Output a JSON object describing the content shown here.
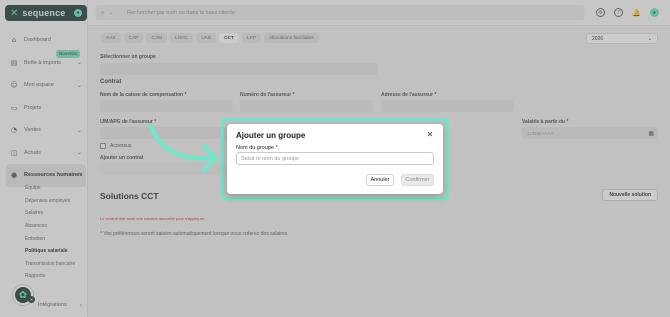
{
  "brand": {
    "name": "sequence",
    "accent": "#65e6c2",
    "dark": "#1f3d3a"
  },
  "sidebar": {
    "items": [
      {
        "label": "Dashboard",
        "icon": "home-icon"
      },
      {
        "label": "Boîte à imports",
        "icon": "inbox-icon",
        "badge": "Nouveau"
      },
      {
        "label": "Mon espace",
        "icon": "user-icon"
      },
      {
        "label": "Projets",
        "icon": "folder-icon"
      },
      {
        "label": "Ventes",
        "icon": "chart-icon"
      },
      {
        "label": "Achats",
        "icon": "cart-icon"
      },
      {
        "label": "Ressources humaines",
        "icon": "people-icon"
      }
    ],
    "sub_items": [
      "Équipe",
      "Dépenses employés",
      "Salaires",
      "Absences",
      "Entretien",
      "Politique salariale",
      "Transmission bancaire",
      "Rapports"
    ],
    "bottom_item": "Intégrations"
  },
  "topbar": {
    "search_placeholder": "Rechercher par nom ou dans la base clients"
  },
  "tabs": [
    "AAS",
    "CAP",
    "CAM",
    "LNHC",
    "UAB",
    "CCT",
    "LPP",
    "Allocations familiales"
  ],
  "year": "2026",
  "form": {
    "group_label": "Sélectionner un groupe",
    "contract_title": "Contrat",
    "fields": [
      "Nom de la caisse de compensation *",
      "Numéro de l'assureur *",
      "Adresse de l'assureur *",
      "IJM/APG de l'assureur *",
      "Valable à partir du *"
    ],
    "date_placeholder": "JJ/MM/AAAA",
    "checkbox_label": "Accessus",
    "add_contract": "Ajouter un contrat"
  },
  "solutions": {
    "title": "Solutions CCT",
    "new_button": "Nouvelle solution",
    "warning": "Le contrat doit avoir une solution associée pour s'appliquer.",
    "note": "* Vos préférences seront saisies automatiquement lorsque vous créerez des salaires"
  },
  "modal": {
    "title": "Ajouter un groupe",
    "field_label": "Nom du groupe *",
    "placeholder": "Saisir le nom du groupe",
    "cancel": "Annuler",
    "confirm": "Confirmer"
  }
}
